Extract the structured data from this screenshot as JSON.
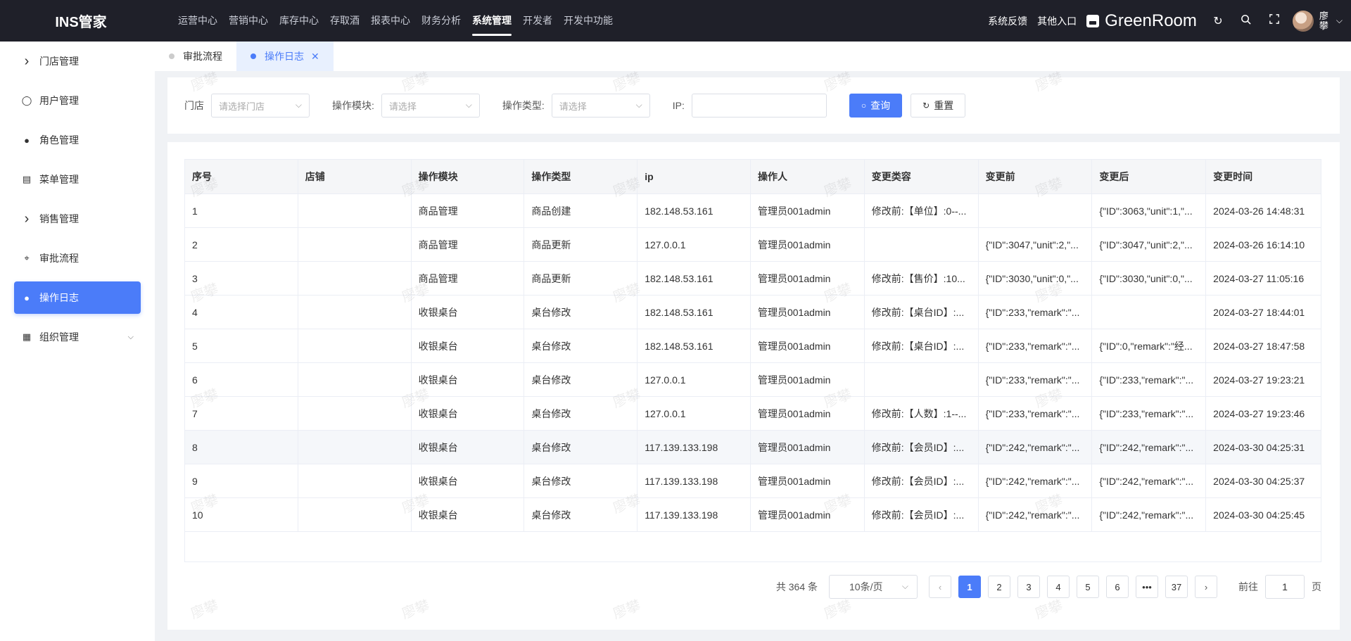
{
  "app": {
    "logo": "INS管家",
    "watermark": "廖攀",
    "accent_color": "#4b7cf9",
    "topbar_color": "#1f2029"
  },
  "topnav": {
    "items": [
      "运营中心",
      "营销中心",
      "库存中心",
      "存取酒",
      "报表中心",
      "财务分析",
      "系统管理",
      "开发者",
      "开发中功能"
    ],
    "active": "系统管理"
  },
  "topright": {
    "feedback": "系统反馈",
    "other_entry": "其他入口",
    "store_name": "GreenRoom",
    "user_name": "廖攀",
    "icons": [
      "refresh-icon",
      "search-icon",
      "fullscreen-icon"
    ]
  },
  "sidebar": {
    "items": [
      {
        "label": "门店管理",
        "icon": "chevron-right-icon"
      },
      {
        "label": "用户管理",
        "icon": "user-outline-icon"
      },
      {
        "label": "角色管理",
        "icon": "user-solid-icon"
      },
      {
        "label": "菜单管理",
        "icon": "document-icon"
      },
      {
        "label": "销售管理",
        "icon": "chevron-right-icon"
      },
      {
        "label": "审批流程",
        "icon": "target-icon"
      },
      {
        "label": "操作日志",
        "icon": "user-solid-icon"
      },
      {
        "label": "组织管理",
        "icon": "building-icon"
      }
    ],
    "active": "操作日志"
  },
  "tabs": [
    {
      "label": "审批流程"
    },
    {
      "label": "操作日志"
    }
  ],
  "filter": {
    "store_label": "门店",
    "store_placeholder": "请选择门店",
    "module_label": "操作模块:",
    "module_placeholder": "请选择",
    "type_label": "操作类型:",
    "type_placeholder": "请选择",
    "ip_label": "IP:",
    "ip_value": "",
    "query_button": "查询",
    "reset_button": "重置"
  },
  "table": {
    "columns": [
      "序号",
      "店铺",
      "操作模块",
      "操作类型",
      "ip",
      "操作人",
      "变更类容",
      "变更前",
      "变更后",
      "变更时间"
    ],
    "rows": [
      [
        "1",
        "",
        "商品管理",
        "商品创建",
        "182.148.53.161",
        "管理员001admin",
        "修改前:【单位】:0--...",
        "",
        "{\"ID\":3063,\"unit\":1,\"...",
        "2024-03-26 14:48:31"
      ],
      [
        "2",
        "",
        "商品管理",
        "商品更新",
        "127.0.0.1",
        "管理员001admin",
        "",
        "{\"ID\":3047,\"unit\":2,\"...",
        "{\"ID\":3047,\"unit\":2,\"...",
        "2024-03-26 16:14:10"
      ],
      [
        "3",
        "",
        "商品管理",
        "商品更新",
        "182.148.53.161",
        "管理员001admin",
        "修改前:【售价】:10...",
        "{\"ID\":3030,\"unit\":0,\"...",
        "{\"ID\":3030,\"unit\":0,\"...",
        "2024-03-27 11:05:16"
      ],
      [
        "4",
        "",
        "收银桌台",
        "桌台修改",
        "182.148.53.161",
        "管理员001admin",
        "修改前:【桌台ID】:...",
        "{\"ID\":233,\"remark\":\"...",
        "",
        "2024-03-27 18:44:01"
      ],
      [
        "5",
        "",
        "收银桌台",
        "桌台修改",
        "182.148.53.161",
        "管理员001admin",
        "修改前:【桌台ID】:...",
        "{\"ID\":233,\"remark\":\"...",
        "{\"ID\":0,\"remark\":\"经...",
        "2024-03-27 18:47:58"
      ],
      [
        "6",
        "",
        "收银桌台",
        "桌台修改",
        "127.0.0.1",
        "管理员001admin",
        "",
        "{\"ID\":233,\"remark\":\"...",
        "{\"ID\":233,\"remark\":\"...",
        "2024-03-27 19:23:21"
      ],
      [
        "7",
        "",
        "收银桌台",
        "桌台修改",
        "127.0.0.1",
        "管理员001admin",
        "修改前:【人数】:1--...",
        "{\"ID\":233,\"remark\":\"...",
        "{\"ID\":233,\"remark\":\"...",
        "2024-03-27 19:23:46"
      ],
      [
        "8",
        "",
        "收银桌台",
        "桌台修改",
        "117.139.133.198",
        "管理员001admin",
        "修改前:【会员ID】:...",
        "{\"ID\":242,\"remark\":\"...",
        "{\"ID\":242,\"remark\":\"...",
        "2024-03-30 04:25:31"
      ],
      [
        "9",
        "",
        "收银桌台",
        "桌台修改",
        "117.139.133.198",
        "管理员001admin",
        "修改前:【会员ID】:...",
        "{\"ID\":242,\"remark\":\"...",
        "{\"ID\":242,\"remark\":\"...",
        "2024-03-30 04:25:37"
      ],
      [
        "10",
        "",
        "收银桌台",
        "桌台修改",
        "117.139.133.198",
        "管理员001admin",
        "修改前:【会员ID】:...",
        "{\"ID\":242,\"remark\":\"...",
        "{\"ID\":242,\"remark\":\"...",
        "2024-03-30 04:25:45"
      ]
    ],
    "highlighted_row": 8
  },
  "pagination": {
    "total": "共 364 条",
    "page_size": "10条/页",
    "pages": [
      "1",
      "2",
      "3",
      "4",
      "5",
      "6",
      "•••",
      "37"
    ],
    "current": "1",
    "goto_label": "前往",
    "goto_value": "1",
    "page_unit": "页"
  }
}
